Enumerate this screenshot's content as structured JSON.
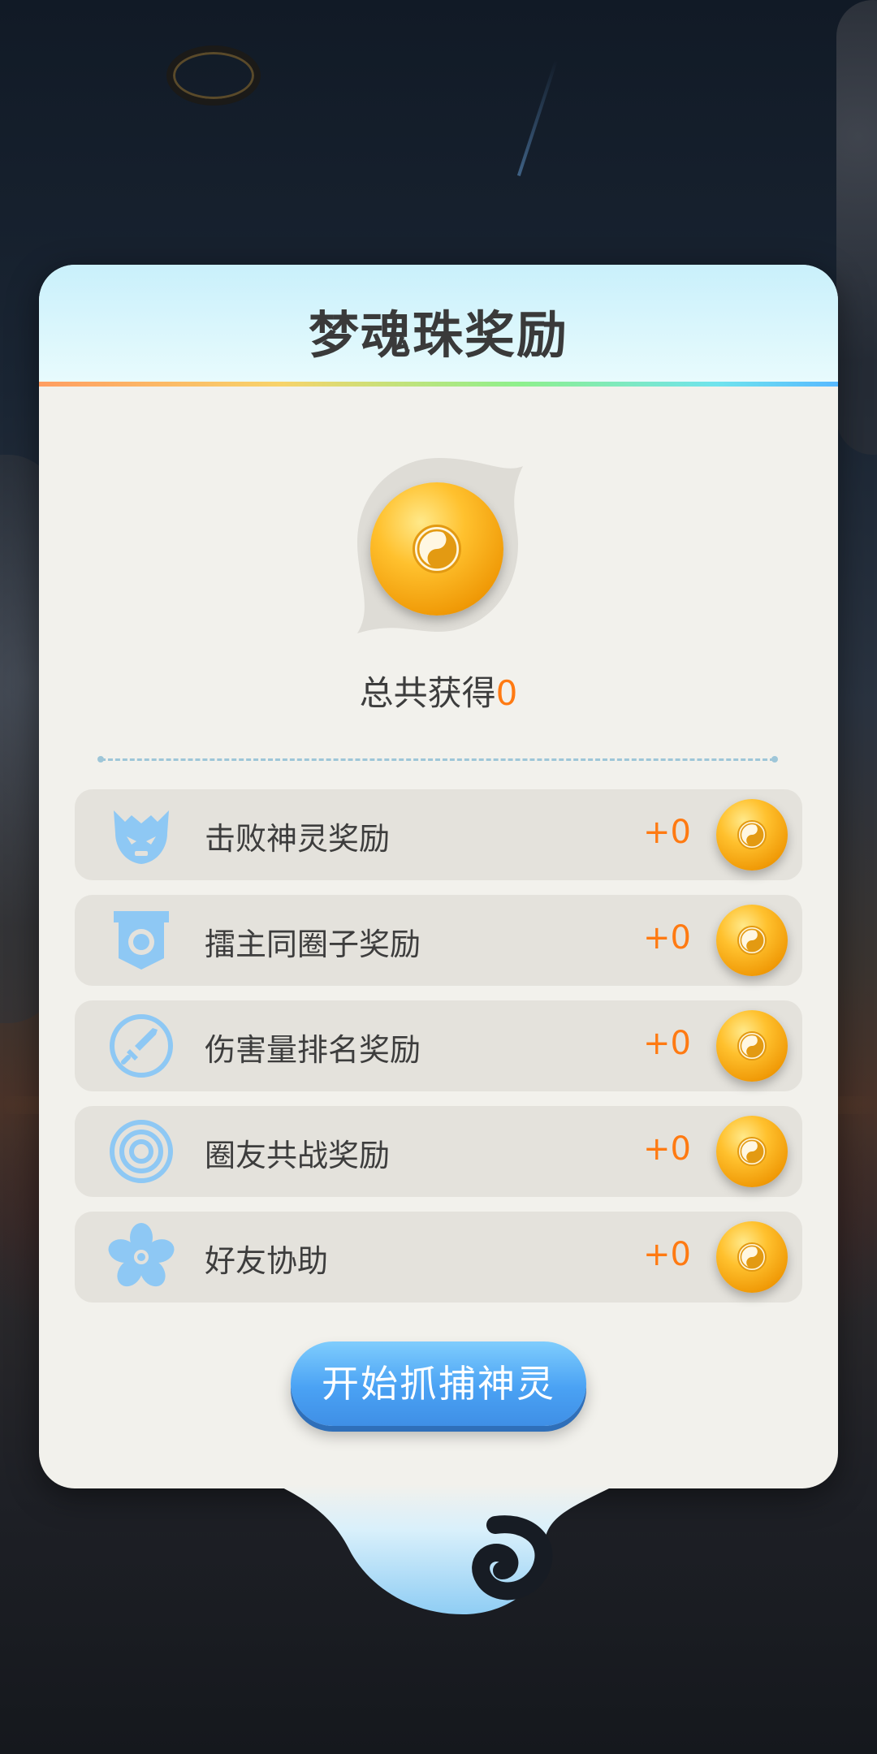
{
  "dialog": {
    "title": "梦魂珠奖励",
    "total_label": "总共获得",
    "total_value": "0",
    "rewards": [
      {
        "label": "击败神灵奖励",
        "value": "+0",
        "icon": "demon-icon"
      },
      {
        "label": "擂主同圈子奖励",
        "value": "+0",
        "icon": "shield-icon"
      },
      {
        "label": "伤害量排名奖励",
        "value": "+0",
        "icon": "sword-icon"
      },
      {
        "label": "圈友共战奖励",
        "value": "+0",
        "icon": "rings-icon"
      },
      {
        "label": "好友协助",
        "value": "+0",
        "icon": "flower-icon"
      }
    ],
    "action_button": "开始抓捕神灵"
  },
  "colors": {
    "accent_orange": "#ff7a12",
    "button_blue": "#4aa2f4",
    "icon_blue": "#8ec8f4",
    "panel": "#f2f1ec",
    "row": "#e4e2dc"
  }
}
